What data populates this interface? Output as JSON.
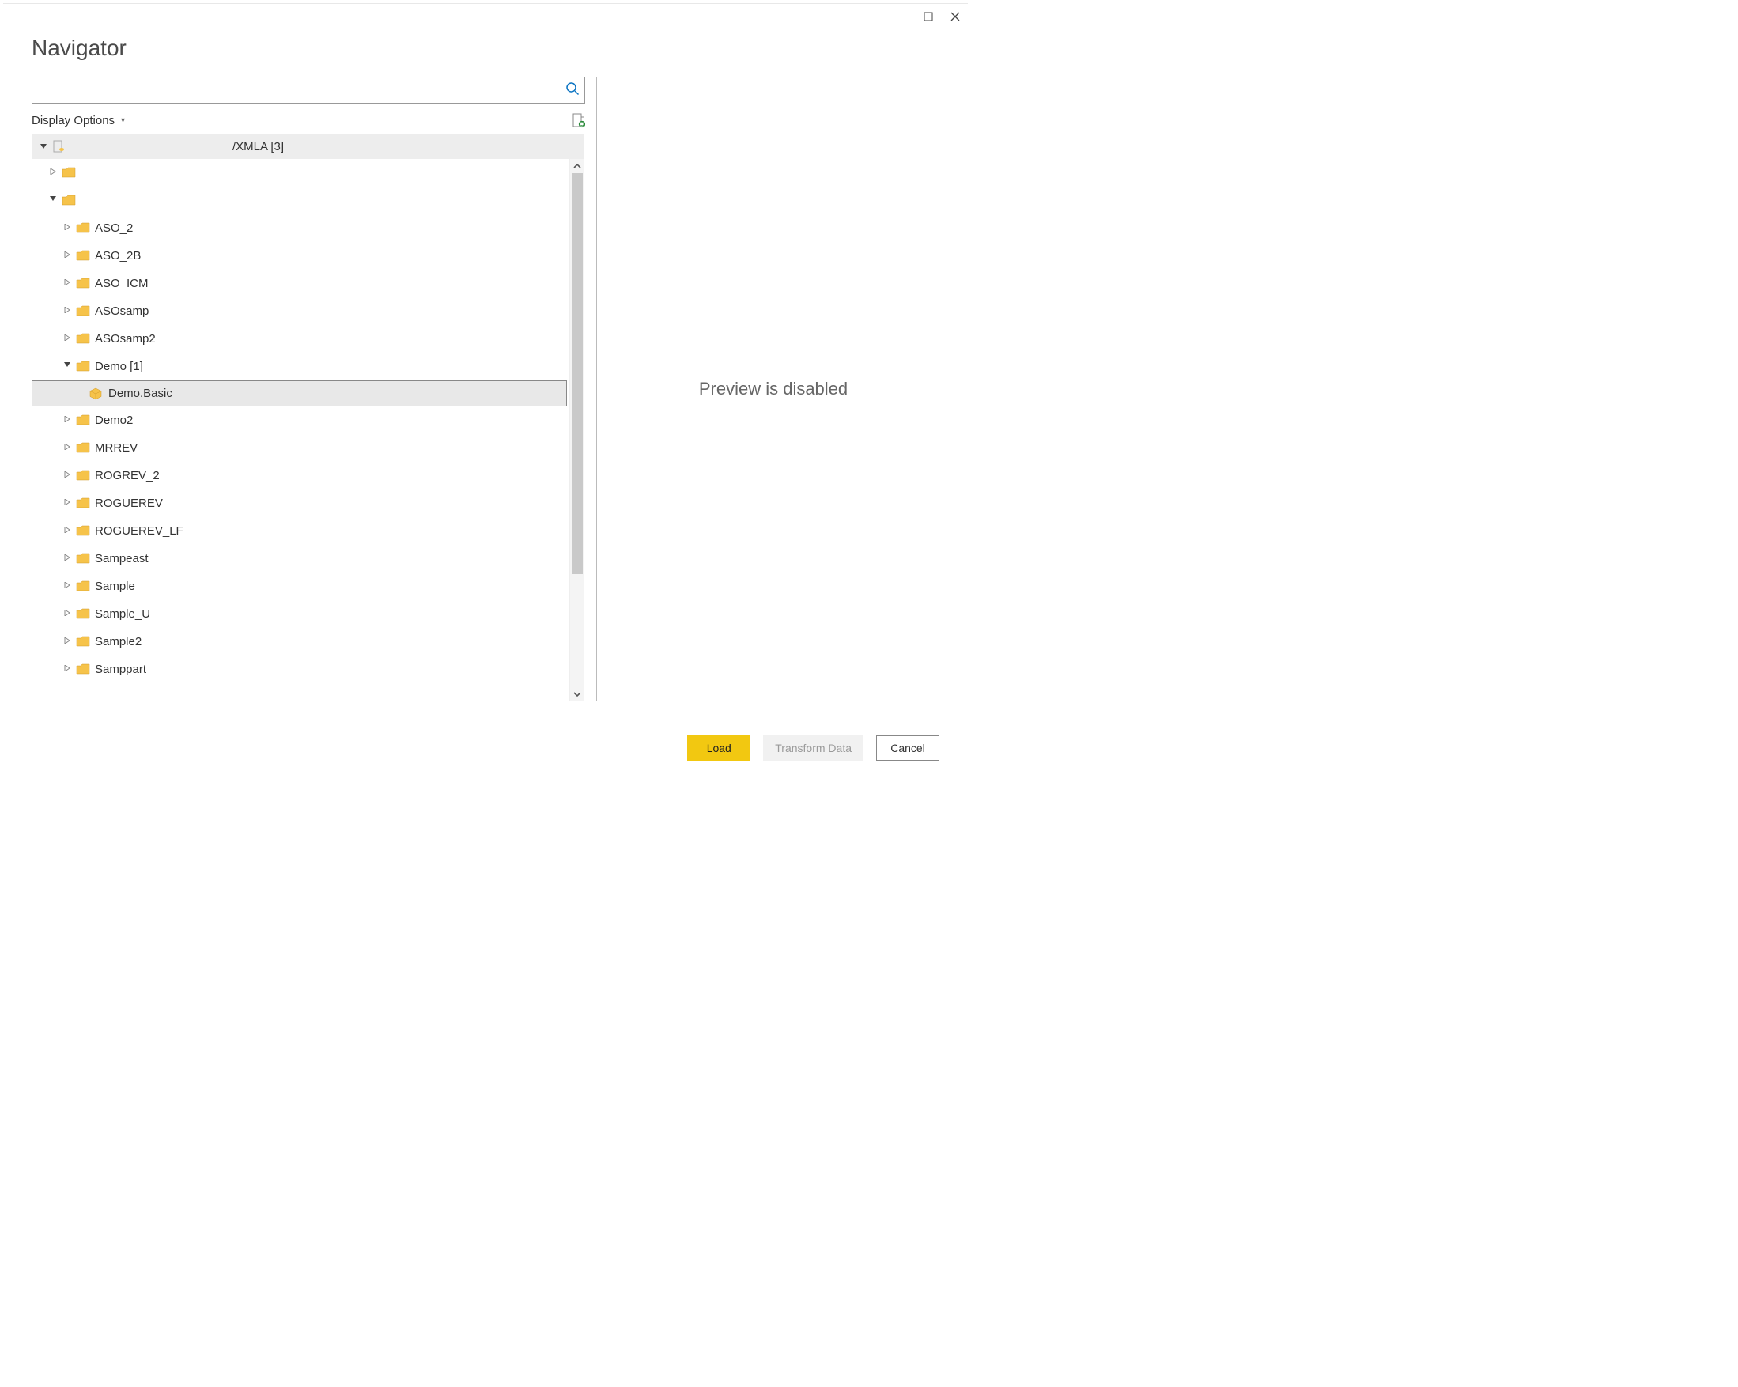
{
  "title": "Navigator",
  "search": {
    "value": "",
    "placeholder": ""
  },
  "options": {
    "display_label": "Display Options"
  },
  "tree": {
    "root_label": "/XMLA [3]",
    "nodes": [
      {
        "indent": 1,
        "expander": "closed",
        "icon": "folder",
        "label": ""
      },
      {
        "indent": 1,
        "expander": "open",
        "icon": "folder",
        "label": ""
      },
      {
        "indent": 2,
        "expander": "closed",
        "icon": "folder",
        "label": "ASO_2"
      },
      {
        "indent": 2,
        "expander": "closed",
        "icon": "folder",
        "label": "ASO_2B"
      },
      {
        "indent": 2,
        "expander": "closed",
        "icon": "folder",
        "label": "ASO_ICM"
      },
      {
        "indent": 2,
        "expander": "closed",
        "icon": "folder",
        "label": "ASOsamp"
      },
      {
        "indent": 2,
        "expander": "closed",
        "icon": "folder",
        "label": "ASOsamp2"
      },
      {
        "indent": 2,
        "expander": "open",
        "icon": "folder",
        "label": "Demo [1]"
      },
      {
        "indent": 3,
        "expander": "none",
        "icon": "cube",
        "label": "Demo.Basic",
        "selected": true
      },
      {
        "indent": 2,
        "expander": "closed",
        "icon": "folder",
        "label": "Demo2"
      },
      {
        "indent": 2,
        "expander": "closed",
        "icon": "folder",
        "label": "MRREV"
      },
      {
        "indent": 2,
        "expander": "closed",
        "icon": "folder",
        "label": "ROGREV_2"
      },
      {
        "indent": 2,
        "expander": "closed",
        "icon": "folder",
        "label": "ROGUEREV"
      },
      {
        "indent": 2,
        "expander": "closed",
        "icon": "folder",
        "label": "ROGUEREV_LF"
      },
      {
        "indent": 2,
        "expander": "closed",
        "icon": "folder",
        "label": "Sampeast"
      },
      {
        "indent": 2,
        "expander": "closed",
        "icon": "folder",
        "label": "Sample"
      },
      {
        "indent": 2,
        "expander": "closed",
        "icon": "folder",
        "label": "Sample_U"
      },
      {
        "indent": 2,
        "expander": "closed",
        "icon": "folder",
        "label": "Sample2"
      },
      {
        "indent": 2,
        "expander": "closed",
        "icon": "folder",
        "label": "Samppart"
      }
    ]
  },
  "preview": {
    "message": "Preview is disabled"
  },
  "footer": {
    "load_label": "Load",
    "transform_label": "Transform Data",
    "cancel_label": "Cancel"
  }
}
